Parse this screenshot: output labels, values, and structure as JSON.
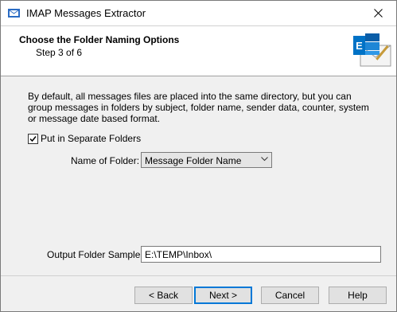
{
  "window": {
    "title": "IMAP Messages Extractor"
  },
  "header": {
    "title": "Choose the Folder Naming Options",
    "step": "Step 3 of 6"
  },
  "description": "By default, all messages files are placed into the same directory, but you can group messages in folders by subject, folder name, sender data, counter, system or message date based format.",
  "options": {
    "separate_folders_label": "Put in Separate Folders",
    "separate_folders_checked": true,
    "folder_name_label": "Name of Folder:",
    "folder_name_value": "Message Folder Name",
    "output_sample_label": "Output Folder Sample:",
    "output_sample_value": "E:\\TEMP\\Inbox\\"
  },
  "buttons": {
    "back": "< Back",
    "next": "Next >",
    "cancel": "Cancel",
    "help": "Help"
  },
  "colors": {
    "accent": "#0078d7",
    "exchange_blue": "#0072c6"
  }
}
